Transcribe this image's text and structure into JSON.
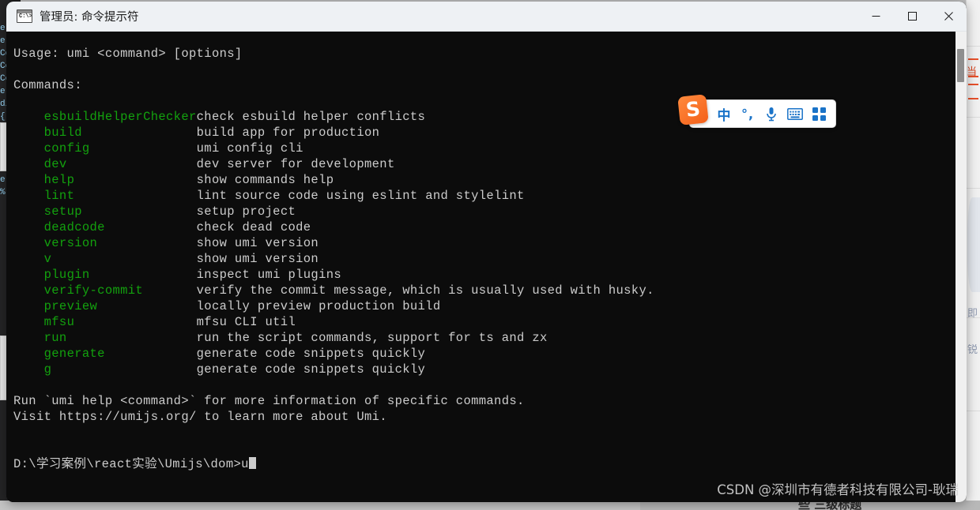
{
  "window": {
    "title": "管理员: 命令提示符",
    "icon": "cmd-prompt-icon",
    "icon_glyph": "C:\\>",
    "controls": {
      "minimize": "minimize-button",
      "maximize": "maximize-button",
      "close": "close-button"
    }
  },
  "terminal": {
    "usage_line": "Usage: umi <command> [options]",
    "commands_heading": "Commands:",
    "commands": [
      {
        "name": "esbuildHelperChecker",
        "desc": "check esbuild helper conflicts"
      },
      {
        "name": "build",
        "desc": "build app for production"
      },
      {
        "name": "config",
        "desc": "umi config cli"
      },
      {
        "name": "dev",
        "desc": "dev server for development"
      },
      {
        "name": "help",
        "desc": "show commands help"
      },
      {
        "name": "lint",
        "desc": "lint source code using eslint and stylelint"
      },
      {
        "name": "setup",
        "desc": "setup project"
      },
      {
        "name": "deadcode",
        "desc": "check dead code"
      },
      {
        "name": "version",
        "desc": "show umi version"
      },
      {
        "name": "v",
        "desc": "show umi version"
      },
      {
        "name": "plugin",
        "desc": "inspect umi plugins"
      },
      {
        "name": "verify-commit",
        "desc": "verify the commit message, which is usually used with husky."
      },
      {
        "name": "preview",
        "desc": "locally preview production build"
      },
      {
        "name": "mfsu",
        "desc": "mfsu CLI util"
      },
      {
        "name": "run",
        "desc": "run the script commands, support for ts and zx"
      },
      {
        "name": "generate",
        "desc": "generate code snippets quickly"
      },
      {
        "name": "g",
        "desc": "generate code snippets quickly"
      }
    ],
    "footer_line_1": "Run `umi help <command>` for more information of specific commands.",
    "footer_line_2": "Visit https://umijs.org/ to learn more about Umi.",
    "prompt_path": "D:\\学习案例\\react实验\\Umijs\\dom>",
    "prompt_input": "u",
    "colors": {
      "background": "#0c0c0c",
      "text": "#cccccc",
      "command_name": "#13a10e"
    }
  },
  "watermark": {
    "text": "CSDN @深圳市有德者科技有限公司-耿瑞"
  },
  "ime_toolbar": {
    "logo_letter": "S",
    "items": [
      {
        "name": "chinese-mode-icon",
        "label": "中"
      },
      {
        "name": "punctuation-mode-icon",
        "label": "°,"
      },
      {
        "name": "voice-input-icon",
        "label": ""
      },
      {
        "name": "soft-keyboard-icon",
        "label": ""
      },
      {
        "name": "ime-menu-icon",
        "label": ""
      }
    ]
  },
  "background": {
    "editor_snippet": "er,\ner,\nCon\nCon\nCon\ner,\ndi\n{ b\n[N]\n%\n]\ns:\ne:\n%",
    "right_doc_chars": [
      "即",
      "锐"
    ],
    "bottom_text": "些 三级标题"
  }
}
